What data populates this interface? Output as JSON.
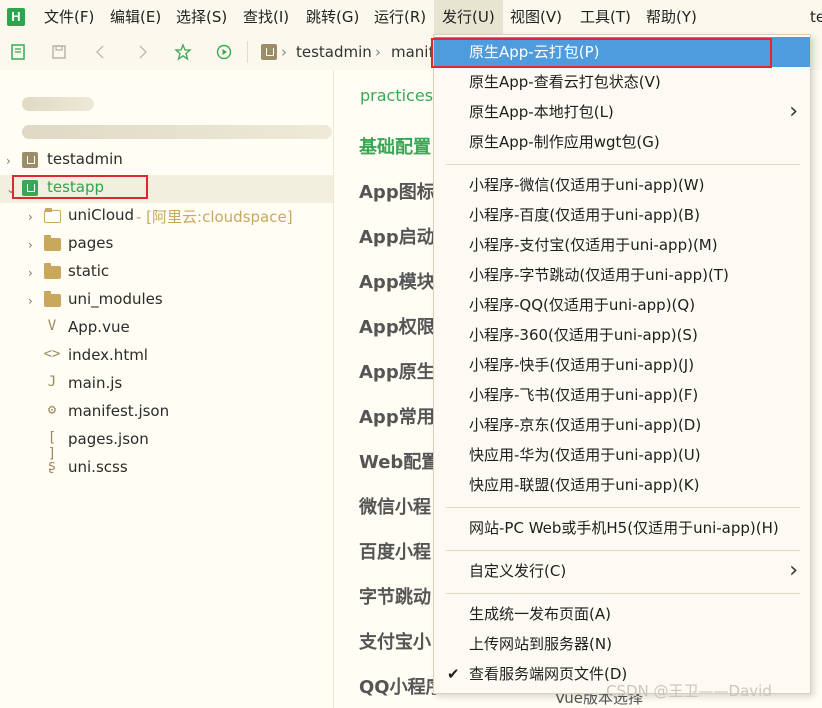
{
  "app": {
    "logo_letter": "H"
  },
  "menubar": {
    "items": [
      "文件(F)",
      "编辑(E)",
      "选择(S)",
      "查找(I)",
      "跳转(G)",
      "运行(R)",
      "发行(U)",
      "视图(V)",
      "工具(T)",
      "帮助(Y)"
    ],
    "active_index": 6,
    "clipped_right_text": "te"
  },
  "toolbar": {
    "breadcrumb": [
      "testadmin",
      "manif"
    ]
  },
  "sidebar": {
    "tree": [
      {
        "label": "testadmin",
        "type": "project"
      },
      {
        "label": "testapp",
        "type": "project",
        "selected": true
      },
      {
        "label": "uniCloud",
        "suffix": " - [阿里云:cloudspace]",
        "type": "cloud-folder"
      },
      {
        "label": "pages",
        "type": "folder"
      },
      {
        "label": "static",
        "type": "folder"
      },
      {
        "label": "uni_modules",
        "type": "folder"
      },
      {
        "label": "App.vue",
        "type": "vue"
      },
      {
        "label": "index.html",
        "type": "html"
      },
      {
        "label": "main.js",
        "type": "js"
      },
      {
        "label": "manifest.json",
        "type": "json"
      },
      {
        "label": "pages.json",
        "type": "json"
      },
      {
        "label": "uni.scss",
        "type": "scss"
      }
    ]
  },
  "main": {
    "link_text": "practices",
    "sections": [
      "基础配置",
      "App图标",
      "App启动",
      "App模块",
      "App权限",
      "App原生",
      "App常用",
      "Web配置",
      "微信小程",
      "百度小程",
      "字节跳动",
      "支付宝小",
      "QQ小程序"
    ],
    "bottom_text": "Vue版本选择"
  },
  "dropdown": {
    "items": [
      {
        "label": "原生App-云打包(P)",
        "highlighted": true
      },
      {
        "label": "原生App-查看云打包状态(V)"
      },
      {
        "label": "原生App-本地打包(L)",
        "submenu": true
      },
      {
        "label": "原生App-制作应用wgt包(G)"
      },
      {
        "separator": true
      },
      {
        "label": "小程序-微信(仅适用于uni-app)(W)"
      },
      {
        "label": "小程序-百度(仅适用于uni-app)(B)"
      },
      {
        "label": "小程序-支付宝(仅适用于uni-app)(M)"
      },
      {
        "label": "小程序-字节跳动(仅适用于uni-app)(T)"
      },
      {
        "label": "小程序-QQ(仅适用于uni-app)(Q)"
      },
      {
        "label": "小程序-360(仅适用于uni-app)(S)"
      },
      {
        "label": "小程序-快手(仅适用于uni-app)(J)"
      },
      {
        "label": "小程序-飞书(仅适用于uni-app)(F)"
      },
      {
        "label": "小程序-京东(仅适用于uni-app)(D)"
      },
      {
        "label": "快应用-华为(仅适用于uni-app)(U)"
      },
      {
        "label": "快应用-联盟(仅适用于uni-app)(K)"
      },
      {
        "separator": true
      },
      {
        "label": "网站-PC Web或手机H5(仅适用于uni-app)(H)"
      },
      {
        "separator": true
      },
      {
        "label": "自定义发行(C)",
        "submenu": true
      },
      {
        "separator": true
      },
      {
        "label": "生成统一发布页面(A)"
      },
      {
        "label": "上传网站到服务器(N)"
      },
      {
        "label": "查看服务端网页文件(D)",
        "checked": true
      }
    ]
  },
  "watermark": "CSDN @王卫——David",
  "colors": {
    "accent_green": "#2fa44f",
    "menu_highlight": "#4e9bde",
    "annotation_red": "#e0262f"
  }
}
